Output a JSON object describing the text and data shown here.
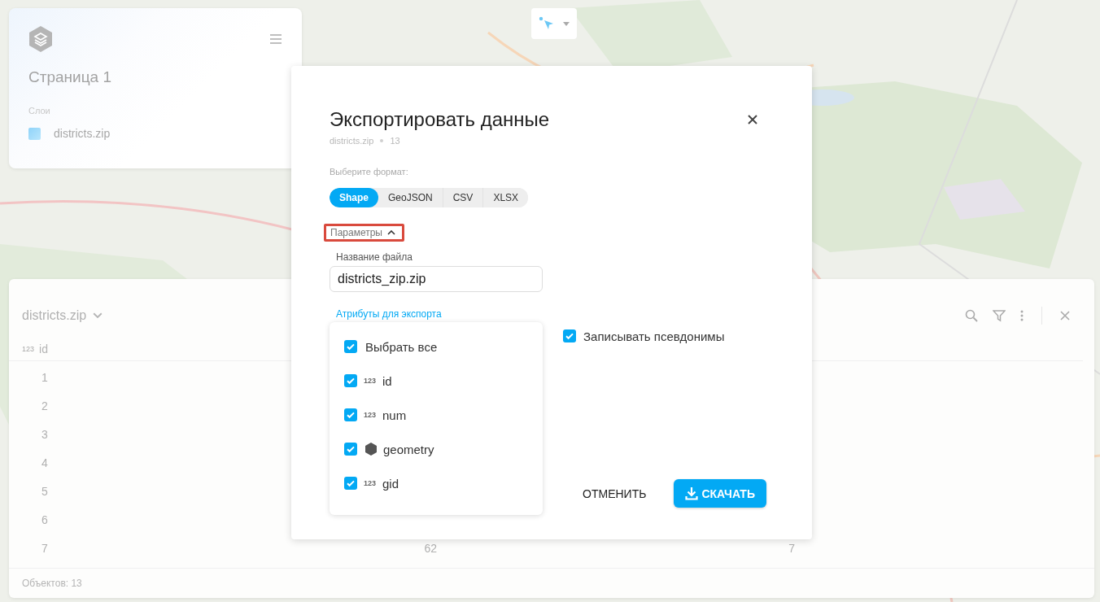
{
  "layers_panel": {
    "page_title": "Страница 1",
    "section_label": "Слои",
    "layers": [
      {
        "name": "districts.zip"
      }
    ]
  },
  "table_panel": {
    "title": "districts.zip",
    "columns": [
      {
        "label": "id",
        "type_label": "123"
      }
    ],
    "rows": [
      {
        "cells": [
          "1"
        ]
      },
      {
        "cells": [
          "2"
        ]
      },
      {
        "cells": [
          "3"
        ]
      },
      {
        "cells": [
          "4"
        ]
      },
      {
        "cells": [
          "5"
        ]
      },
      {
        "cells": [
          "6"
        ]
      },
      {
        "cells": [
          "7",
          "62",
          "7"
        ]
      }
    ],
    "footer": "Объектов: 13"
  },
  "export_dialog": {
    "title": "Экспортировать данные",
    "subtitle_file": "districts.zip",
    "subtitle_count": "13",
    "format_label": "Выберите формат:",
    "formats": [
      {
        "label": "Shape",
        "selected": true
      },
      {
        "label": "GeoJSON",
        "selected": false
      },
      {
        "label": "CSV",
        "selected": false
      },
      {
        "label": "XLSX",
        "selected": false
      }
    ],
    "parameters_toggle": {
      "label": "Параметры",
      "expanded": true,
      "highlighted": true
    },
    "file_name": {
      "label": "Название файла",
      "value": "districts_zip.zip"
    },
    "attributes_label": "Атрибуты для экспорта",
    "attributes": [
      {
        "kind": "select_all",
        "label": "Выбрать все",
        "checked": true
      },
      {
        "kind": "number",
        "type_label": "123",
        "label": "id",
        "checked": true
      },
      {
        "kind": "number",
        "type_label": "123",
        "label": "num",
        "checked": true
      },
      {
        "kind": "geometry",
        "label": "geometry",
        "checked": true
      },
      {
        "kind": "number",
        "type_label": "123",
        "label": "gid",
        "checked": true
      }
    ],
    "write_aliases": {
      "label": "Записывать псевдонимы",
      "checked": true
    },
    "buttons": [
      {
        "kind": "text",
        "label": "ОТМЕНИТЬ"
      },
      {
        "kind": "primary",
        "label": "СКАЧАТЬ"
      }
    ]
  }
}
